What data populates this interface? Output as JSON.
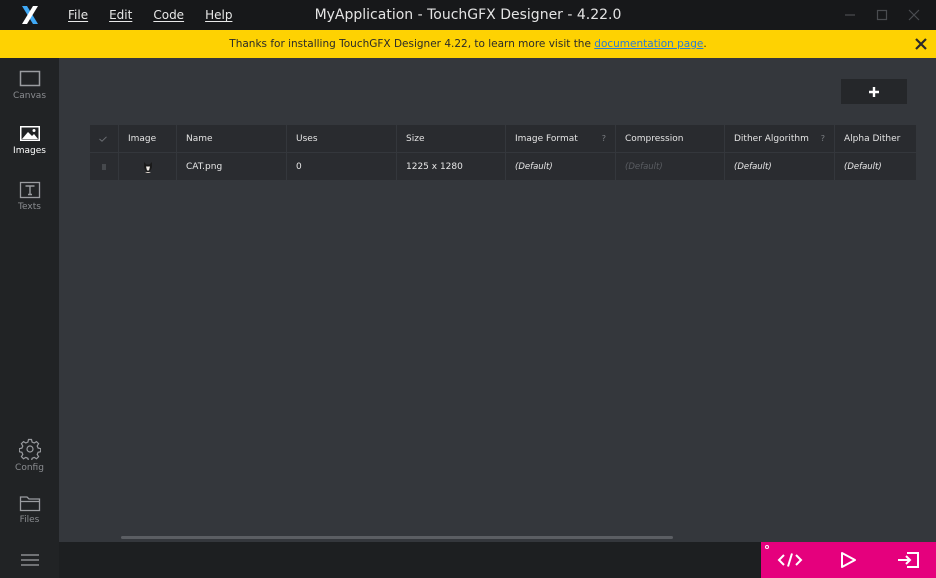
{
  "titlebar": {
    "menu": [
      "File",
      "Edit",
      "Code",
      "Help"
    ],
    "title": "MyApplication - TouchGFX Designer - 4.22.0"
  },
  "banner": {
    "text": "Thanks for installing TouchGFX Designer 4.22, to learn more visit the",
    "link": "documentation page",
    "suffix": "."
  },
  "sidebar": {
    "items": [
      {
        "label": "Canvas",
        "icon": "canvas-icon"
      },
      {
        "label": "Images",
        "icon": "image-icon",
        "active": true
      },
      {
        "label": "Texts",
        "icon": "text-icon"
      },
      {
        "label": "Config",
        "icon": "gear-icon"
      },
      {
        "label": "Files",
        "icon": "folder-icon"
      }
    ]
  },
  "images_table": {
    "columns": [
      "Image",
      "Name",
      "Uses",
      "Size",
      "Image Format",
      "Compression",
      "Dither Algorithm",
      "Alpha Dither"
    ],
    "rows": [
      {
        "name": "CAT.png",
        "uses": "0",
        "size": "1225 x 1280",
        "image_format": "(Default)",
        "compression": "(Default)",
        "dither_algorithm": "(Default)",
        "alpha_dither": "(Default)"
      }
    ]
  },
  "colors": {
    "banner": "#fed202",
    "accent": "#e5007d",
    "link": "#2a7bd6"
  }
}
